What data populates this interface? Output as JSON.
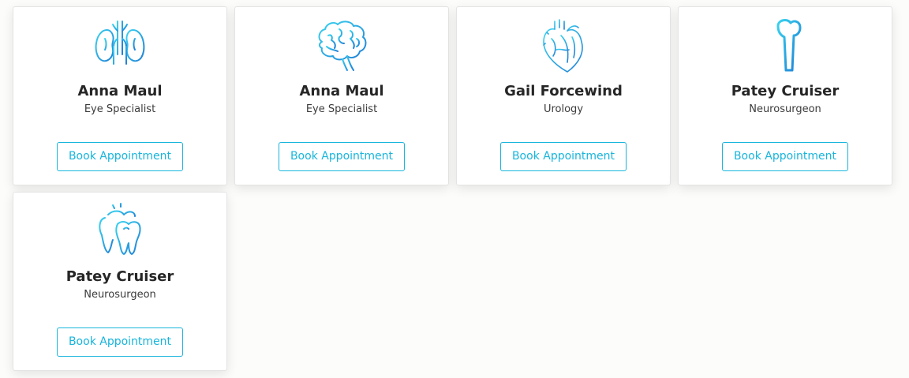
{
  "accent": "#18b5dc",
  "doctors": [
    {
      "icon": "kidneys-icon",
      "name": "Anna Maul",
      "specialty": "Eye Specialist",
      "button_label": "Book Appointment"
    },
    {
      "icon": "brain-icon",
      "name": "Anna Maul",
      "specialty": "Eye Specialist",
      "button_label": "Book Appointment"
    },
    {
      "icon": "heart-icon",
      "name": "Gail Forcewind",
      "specialty": "Urology",
      "button_label": "Book Appointment"
    },
    {
      "icon": "bone-icon",
      "name": "Patey Cruiser",
      "specialty": "Neurosurgeon",
      "button_label": "Book Appointment"
    },
    {
      "icon": "teeth-icon",
      "name": "Patey Cruiser",
      "specialty": "Neurosurgeon",
      "button_label": "Book Appointment"
    }
  ]
}
